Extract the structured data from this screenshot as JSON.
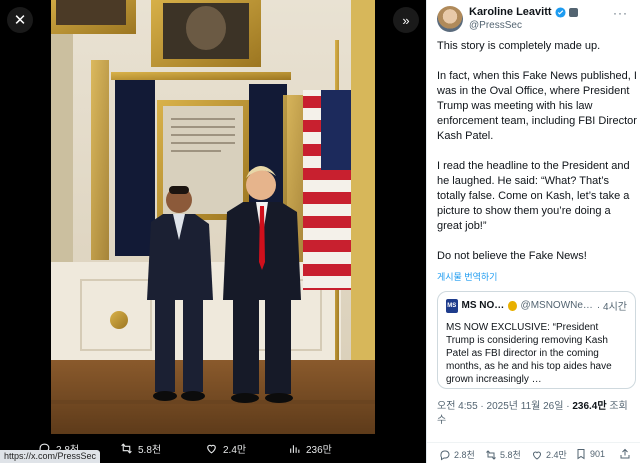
{
  "viewer": {
    "close_icon": "close-icon",
    "expand_icon": "chevron-double-right-icon",
    "bar": {
      "replies": "2.8천",
      "reposts": "5.8천",
      "likes": "2.4만",
      "views": "236만"
    },
    "status_url": "https://x.com/PressSec"
  },
  "tweet": {
    "author_name": "Karoline Leavitt",
    "author_handle": "@PressSec",
    "paragraphs": [
      "This story is completely made up.",
      "In fact, when this Fake News published, I was in the Oval Office, where President Trump was meeting with his law enforcement team, including FBI Director Kash Patel.",
      "I read the headline to the President and he laughed. He said: “What? That’s totally false. Come on Kash, let’s take a picture to show them you’re doing a great job!”",
      "Do not believe the Fake News!"
    ],
    "translate_label": "게시물 번역하기",
    "quote": {
      "logo_text": "MS",
      "name": "MS NO…",
      "handle": "@MSNOWNe…",
      "time": "· 4시간",
      "text": "MS NOW EXCLUSIVE: “President Trump is considering removing Kash Patel as FBI director in the coming months, as he and his top aides have grown increasingly …"
    },
    "meta": {
      "time_date": "오전 4:55 · 2025년 11월 26일 ·",
      "views": "236.4만",
      "views_label": "조회",
      "views_suffix": "수"
    },
    "actions": {
      "replies": "2.8천",
      "reposts": "5.8천",
      "likes": "2.4만",
      "bookmarks": "901"
    }
  },
  "colors": {
    "accent": "#1d9bf0",
    "verified": "#1d9bf0",
    "quote_badge": "#e8b000"
  }
}
